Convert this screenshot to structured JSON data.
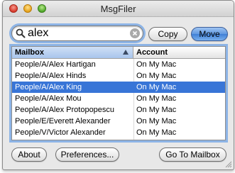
{
  "window": {
    "title": "MsgFiler"
  },
  "search": {
    "value": "alex"
  },
  "actions": {
    "copy_label": "Copy",
    "move_label": "Move"
  },
  "table": {
    "columns": [
      "Mailbox",
      "Account"
    ],
    "rows": [
      {
        "mailbox": "People/A/Alex Hartigan",
        "account": "On My Mac",
        "selected": false
      },
      {
        "mailbox": "People/A/Alex Hinds",
        "account": "On My Mac",
        "selected": false
      },
      {
        "mailbox": "People/A/Alex King",
        "account": "On My Mac",
        "selected": true
      },
      {
        "mailbox": "People/A/Alex Mou",
        "account": "On My Mac",
        "selected": false
      },
      {
        "mailbox": "People/A/Alex Protopopescu",
        "account": "On My Mac",
        "selected": false
      },
      {
        "mailbox": "People/E/Everett Alexander",
        "account": "On My Mac",
        "selected": false
      },
      {
        "mailbox": "People/V/Victor Alexander",
        "account": "On My Mac",
        "selected": false
      }
    ]
  },
  "footer": {
    "about_label": "About",
    "preferences_label": "Preferences...",
    "goto_label": "Go To Mailbox"
  },
  "colors": {
    "selection": "#3875d7",
    "focus_ring": "#8db4e6",
    "default_button": "#5f98e0"
  },
  "icons": {
    "search": "search-icon",
    "clear": "clear-search-icon",
    "sort": "sort-ascending-icon"
  }
}
